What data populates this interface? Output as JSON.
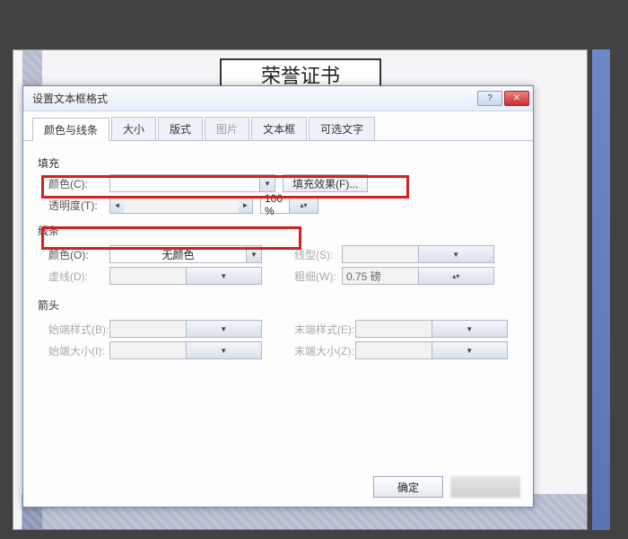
{
  "bg": {
    "title_text": "荣誉证书"
  },
  "dialog": {
    "title": "设置文本框格式",
    "tabs": {
      "color_line": "颜色与线条",
      "size": "大小",
      "layout": "版式",
      "image": "图片",
      "textbox": "文本框",
      "alt_text": "可选文字"
    },
    "fill": {
      "section": "填充",
      "color_label": "颜色(C):",
      "fx_button": "填充效果(F)...",
      "opacity_label": "透明度(T):",
      "opacity_value": "100 %"
    },
    "line": {
      "section": "线条",
      "color_label": "颜色(O):",
      "color_value": "无颜色",
      "style_label": "线型(S):",
      "dash_label": "虚线(D):",
      "weight_label": "粗细(W):",
      "weight_value": "0.75 磅"
    },
    "arrow": {
      "section": "箭头",
      "begin_style": "始端样式(B):",
      "end_style": "末端样式(E):",
      "begin_size": "始端大小(I):",
      "end_size": "末端大小(Z):"
    },
    "ok": "确定"
  }
}
